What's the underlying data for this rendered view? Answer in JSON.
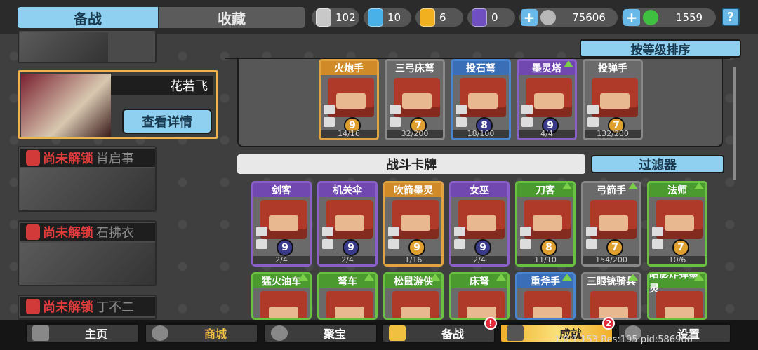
{
  "tabs": [
    "备战",
    "收藏"
  ],
  "resources": [
    {
      "icon": "silver-shield-icon",
      "value": "102",
      "color": "#c8c8c8"
    },
    {
      "icon": "blue-crystal-icon",
      "value": "10",
      "color": "#4ab0e8"
    },
    {
      "icon": "gold-shield-icon",
      "value": "6",
      "color": "#f0b020"
    },
    {
      "icon": "purple-gem-icon",
      "value": "0",
      "color": "#7050c0"
    }
  ],
  "currencies": [
    {
      "icon": "silver-coin-icon",
      "value": "75606",
      "color": "#b8b8b8"
    },
    {
      "icon": "green-jade-icon",
      "value": "1559",
      "color": "#40c040"
    }
  ],
  "help_label": "?",
  "heroes": {
    "selected": {
      "name": "花若飞",
      "detail_button": "查看详情"
    },
    "locked": [
      {
        "status": "尚未解锁",
        "name": "肖启事"
      },
      {
        "status": "尚未解锁",
        "name": "石拂衣"
      },
      {
        "status": "尚未解锁",
        "name": "丁不二"
      }
    ]
  },
  "sort_button": "按等级排序",
  "equipped_units": [
    {
      "name": "火炮手",
      "level": "9",
      "count": "14/16",
      "rarity": "gold"
    },
    {
      "name": "三弓床弩",
      "level": "7",
      "count": "32/200",
      "rarity": "grey"
    },
    {
      "name": "投石弩",
      "level": "8",
      "count": "18/100",
      "rarity": "blue"
    },
    {
      "name": "墨灵塔",
      "level": "9",
      "count": "4/4",
      "rarity": "purple",
      "upgrade": true
    },
    {
      "name": "投弹手",
      "level": "7",
      "count": "132/200",
      "rarity": "grey"
    }
  ],
  "battle_cards_label": "战斗卡牌",
  "filter_button": "过滤器",
  "battle_cards_row1": [
    {
      "name": "剑客",
      "level": "9",
      "count": "2/4",
      "rarity": "purple"
    },
    {
      "name": "机关伞",
      "level": "9",
      "count": "2/4",
      "rarity": "purple"
    },
    {
      "name": "吹箭墨灵",
      "level": "9",
      "count": "1/16",
      "rarity": "gold"
    },
    {
      "name": "女巫",
      "level": "9",
      "count": "2/4",
      "rarity": "purple"
    },
    {
      "name": "刀客",
      "level": "8",
      "count": "11/10",
      "rarity": "green",
      "upgrade": true
    },
    {
      "name": "弓箭手",
      "level": "7",
      "count": "154/200",
      "rarity": "grey",
      "upgrade": true
    },
    {
      "name": "法师",
      "level": "7",
      "count": "10/6",
      "rarity": "green",
      "upgrade": true
    }
  ],
  "battle_cards_row2": [
    {
      "name": "猛火油车",
      "rarity": "green",
      "upgrade": true
    },
    {
      "name": "弩车",
      "rarity": "green",
      "upgrade": true
    },
    {
      "name": "松鼠游侠",
      "rarity": "green",
      "upgrade": true
    },
    {
      "name": "床弩",
      "rarity": "green",
      "upgrade": true
    },
    {
      "name": "重斧手",
      "rarity": "blue",
      "upgrade": true
    },
    {
      "name": "三眼铳骑兵",
      "rarity": "grey",
      "upgrade": true
    },
    {
      "name": "暗影炸弹墨灵",
      "rarity": "green",
      "upgrade": true
    }
  ],
  "nav": [
    {
      "label": "主页",
      "icon": "home-icon"
    },
    {
      "label": "商城",
      "icon": "coins-icon"
    },
    {
      "label": "聚宝",
      "icon": "eye-icon"
    },
    {
      "label": "备战",
      "icon": "card-icon",
      "badge": "!"
    },
    {
      "label": "成就",
      "icon": "grid-icon",
      "badge": "2"
    },
    {
      "label": "设置",
      "icon": "gear-icon"
    }
  ],
  "version_text": "1.0.1.153 Res:195 pid:586966"
}
